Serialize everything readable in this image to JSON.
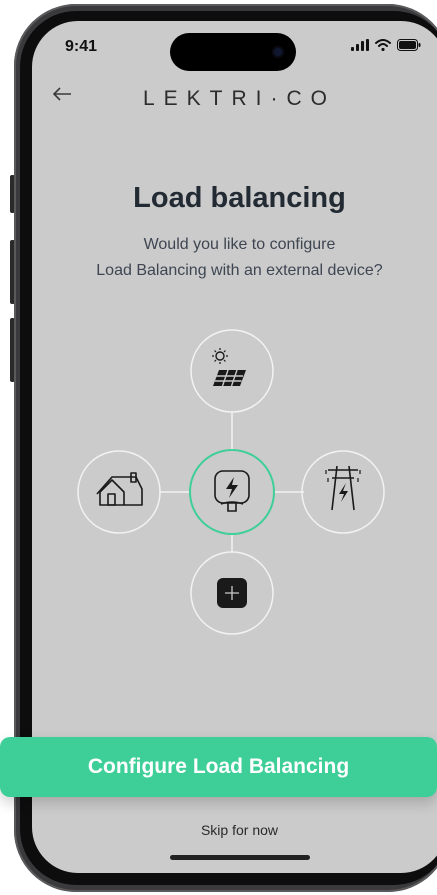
{
  "status_bar": {
    "time": "9:41"
  },
  "header": {
    "back_icon": "arrow-left-icon",
    "logo_text": "LEKTRI·CO"
  },
  "main": {
    "title": "Load balancing",
    "subtitle_line1": "Would you like to configure",
    "subtitle_line2": "Load Balancing with an external device?"
  },
  "diagram": {
    "center": "charger-icon",
    "top": "solar-panel-icon",
    "left": "house-icon",
    "right": "power-pylon-icon",
    "bottom": "meter-icon",
    "accent_color": "#3ecf99"
  },
  "actions": {
    "primary_label": "Configure Load Balancing",
    "skip_label": "Skip for now"
  },
  "colors": {
    "screen_bg": "#cbcbcb",
    "accent": "#3ecf99",
    "text_dark": "#222a33"
  }
}
